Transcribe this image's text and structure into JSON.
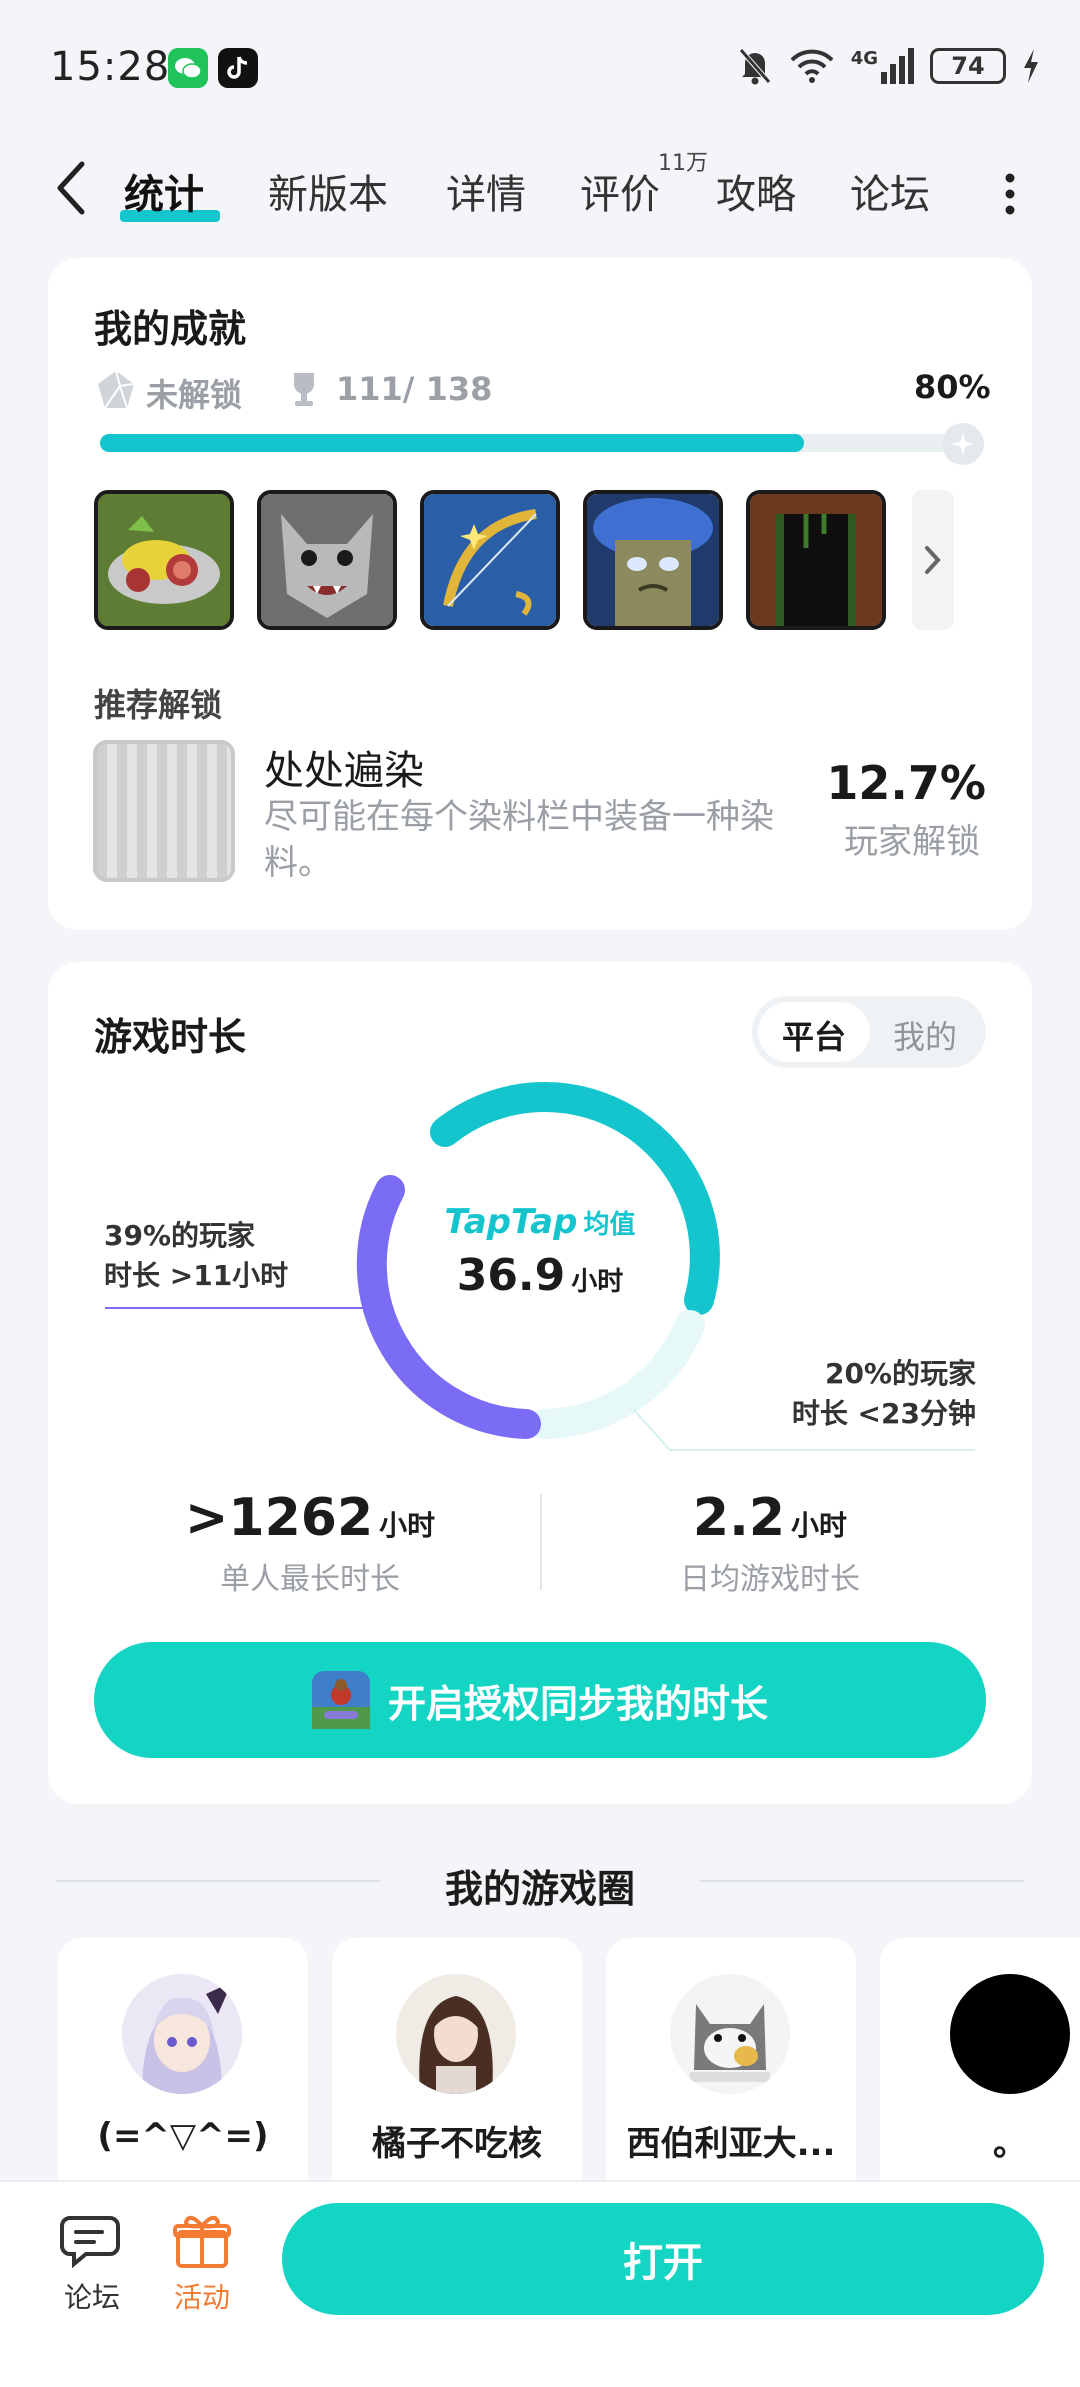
{
  "status_bar": {
    "time": "15:28",
    "network": "4G",
    "battery": "74"
  },
  "nav": {
    "tabs": [
      {
        "label": "统计"
      },
      {
        "label": "新版本"
      },
      {
        "label": "详情"
      },
      {
        "label": "评价"
      },
      {
        "label": "攻略"
      },
      {
        "label": "论坛"
      }
    ],
    "review_count": "11万"
  },
  "achievements": {
    "title": "我的成就",
    "status": "未解锁",
    "count": "111/ 138",
    "percent": "80%",
    "progress": 0.8,
    "recommend_title": "推荐解锁",
    "recommend": {
      "name": "处处遍染",
      "description": "尽可能在每个染料栏中装备一种染料。",
      "rate": "12.7%",
      "rate_label": "玩家解锁"
    }
  },
  "playtime": {
    "title": "游戏时长",
    "toggle": {
      "platform": "平台",
      "mine": "我的"
    },
    "brand": "TapTap",
    "avg_label": "均值",
    "avg_value": "36.9",
    "avg_unit": "小时",
    "left_note_1": "39%的玩家",
    "left_note_2": "时长 >11小时",
    "right_note_1": "20%的玩家",
    "right_note_2": "时长 <23分钟",
    "max_value": ">1262",
    "max_unit": "小时",
    "max_label": "单人最长时长",
    "daily_value": "2.2",
    "daily_unit": "小时",
    "daily_label": "日均游戏时长",
    "sync_label": "开启授权同步我的时长",
    "ring": {
      "high_share": 0.39,
      "low_share": 0.2,
      "high_color": "#7b6cf6",
      "low_color": "#e6f8f8",
      "mid_color": "#15c5ce"
    }
  },
  "circle": {
    "title": "我的游戏圈",
    "members": [
      {
        "name": "(=^▽^=)"
      },
      {
        "name": "橘子不吃核"
      },
      {
        "name": "西伯利亚大..."
      },
      {
        "name": "。"
      }
    ]
  },
  "bottom_bar": {
    "forum": "论坛",
    "activity": "活动",
    "open": "打开",
    "activity_color": "#f47b34"
  },
  "colors": {
    "accent": "#15c5ce",
    "button": "#14d4c4"
  }
}
